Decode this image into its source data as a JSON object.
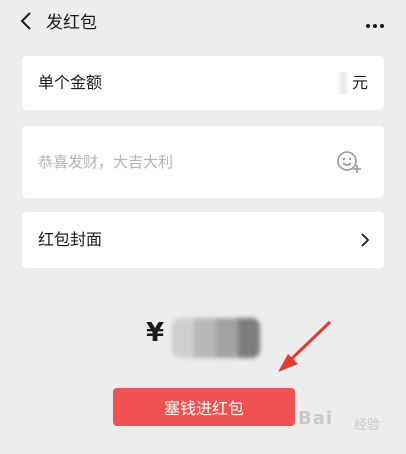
{
  "header": {
    "title": "发红包"
  },
  "amount": {
    "label": "单个金额",
    "value": "",
    "unit": "元"
  },
  "message": {
    "placeholder": "恭喜发财，大吉大利"
  },
  "cover": {
    "label": "红包封面"
  },
  "total": {
    "currency_symbol": "¥"
  },
  "submit": {
    "label": "塞钱进红包"
  },
  "watermark": {
    "logo": "Bai",
    "sub": "经验"
  },
  "colors": {
    "background": "#ededed",
    "card": "#ffffff",
    "accent": "#f05252",
    "arrow": "#e53935"
  }
}
